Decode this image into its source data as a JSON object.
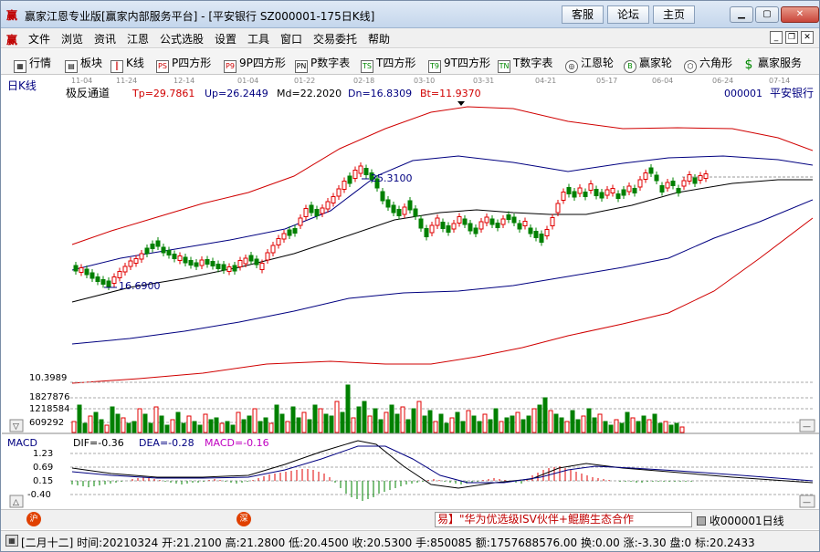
{
  "window": {
    "title": "赢家江恩专业版[赢家内部服务平台] - [平安银行   SZ000001-175日K线]",
    "links": [
      "客服",
      "论坛",
      "主页"
    ]
  },
  "menu": [
    "文件",
    "浏览",
    "资讯",
    "江恩",
    "公式选股",
    "设置",
    "工具",
    "窗口",
    "交易委托",
    "帮助"
  ],
  "toolbar": [
    {
      "label": "行情",
      "icon": "grid-icon"
    },
    {
      "label": "板块",
      "icon": "blocks-icon"
    },
    {
      "label": "K线",
      "icon": "candle-icon"
    },
    {
      "label": "P四方形",
      "icon": "ps-icon"
    },
    {
      "label": "9P四方形",
      "icon": "p9-icon"
    },
    {
      "label": "P数字表",
      "icon": "pn-icon"
    },
    {
      "label": "T四方形",
      "icon": "ts-icon"
    },
    {
      "label": "9T四方形",
      "icon": "t9-icon"
    },
    {
      "label": "T数字表",
      "icon": "tn-icon"
    },
    {
      "label": "江恩轮",
      "icon": "wheel-icon"
    },
    {
      "label": "赢家轮",
      "icon": "big-icon"
    },
    {
      "label": "六角形",
      "icon": "hexagon-icon"
    },
    {
      "label": "赢家服务",
      "icon": "dollar-icon"
    }
  ],
  "chart_header": {
    "period": "日K线",
    "date_ticks": [
      "11-04",
      "11-24",
      "12-14",
      "01-04",
      "01-22",
      "02-18",
      "03-10",
      "03-31",
      "04-21",
      "05-17",
      "06-04",
      "06-24",
      "07-14"
    ],
    "indicator": "极反通道",
    "tp": "Tp=29.7861",
    "up": "Up=26.2449",
    "md": "Md=22.2020",
    "dn": "Dn=16.8309",
    "bt": "Bt=11.9370",
    "symbol": "000001",
    "name": "平安银行",
    "high_label": "25.3100",
    "low_label": "16.6900",
    "bottom_price": "10.3989"
  },
  "volume": {
    "ticks": [
      "1827876",
      "1218584",
      "609292"
    ]
  },
  "macd": {
    "label": "MACD",
    "dif": "DIF=-0.36",
    "dea": "DEA=-0.28",
    "macd": "MACD=-0.16",
    "ticks": [
      "1.23",
      "0.69",
      "0.15",
      "-0.40"
    ]
  },
  "infobar": {
    "ticker": "易】\"华为优选级ISV伙伴+鲲鹏生态合作",
    "receive": "收000001日线",
    "badge_left": "沪",
    "badge_mid": "深"
  },
  "status": "[二月十二] 时间:20210324 开:21.2100 高:21.2800 低:20.4500 收:20.5300 手:850085 额:1757688576.00 换:0.00 涨:-3.30 盘:0 标:20.2433",
  "colors": {
    "up": "#e00000",
    "down": "#008000",
    "band_outer": "#d00000",
    "band_inner": "#000080",
    "mid": "#000000"
  }
}
